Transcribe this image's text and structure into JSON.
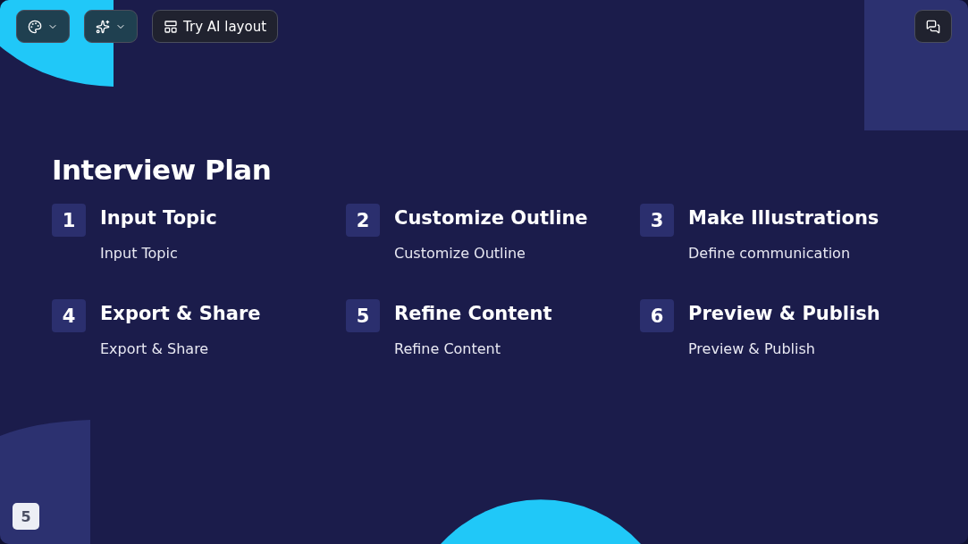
{
  "toolbar": {
    "layout_button": "Try AI layout"
  },
  "slide": {
    "title": "Interview Plan",
    "steps": [
      {
        "number": "1",
        "title": "Input Topic",
        "description": "Input Topic"
      },
      {
        "number": "2",
        "title": "Customize Outline",
        "description": "Customize Outline"
      },
      {
        "number": "3",
        "title": "Make Illustrations",
        "description": "Define communication"
      },
      {
        "number": "4",
        "title": "Export & Share",
        "description": "Export & Share"
      },
      {
        "number": "5",
        "title": "Refine Content",
        "description": "Refine Content"
      },
      {
        "number": "6",
        "title": "Preview & Publish",
        "description": "Preview & Publish"
      }
    ]
  },
  "page_number": "5"
}
